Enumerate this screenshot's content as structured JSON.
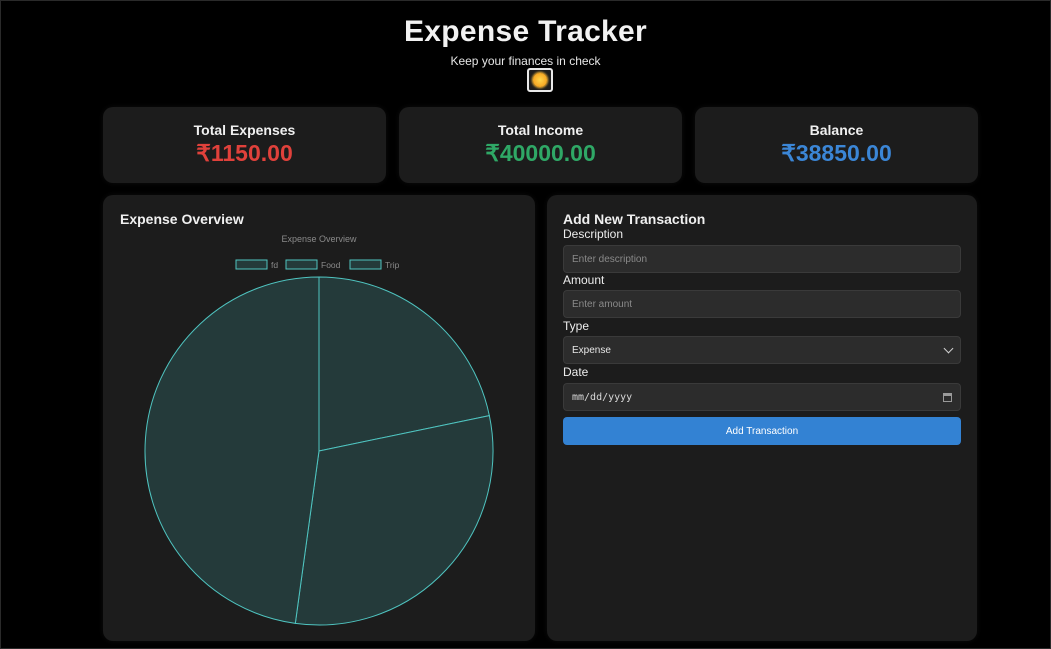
{
  "header": {
    "title": "Expense Tracker",
    "subtitle": "Keep your finances in check",
    "theme_icon": "sun-icon"
  },
  "summary": {
    "expenses": {
      "label": "Total Expenses",
      "value": "₹1150.00",
      "color": "#e0413b"
    },
    "income": {
      "label": "Total Income",
      "value": "₹40000.00",
      "color": "#2fa866"
    },
    "balance": {
      "label": "Balance",
      "value": "₹38850.00",
      "color": "#3b86d6"
    }
  },
  "overview": {
    "heading": "Expense Overview"
  },
  "chart_data": {
    "type": "pie",
    "title": "Expense Overview",
    "categories": [
      "fd",
      "Food",
      "Trip"
    ],
    "values": [
      250,
      350,
      550
    ],
    "legend": "top",
    "fill": "#243a3a",
    "stroke": "#4fc4c0"
  },
  "form": {
    "heading": "Add New Transaction",
    "description": {
      "label": "Description",
      "placeholder": "Enter description"
    },
    "amount": {
      "label": "Amount",
      "placeholder": "Enter amount"
    },
    "type": {
      "label": "Type",
      "value": "Expense"
    },
    "date": {
      "label": "Date",
      "value": "mm/dd/yyyy"
    },
    "submit_label": "Add Transaction"
  }
}
